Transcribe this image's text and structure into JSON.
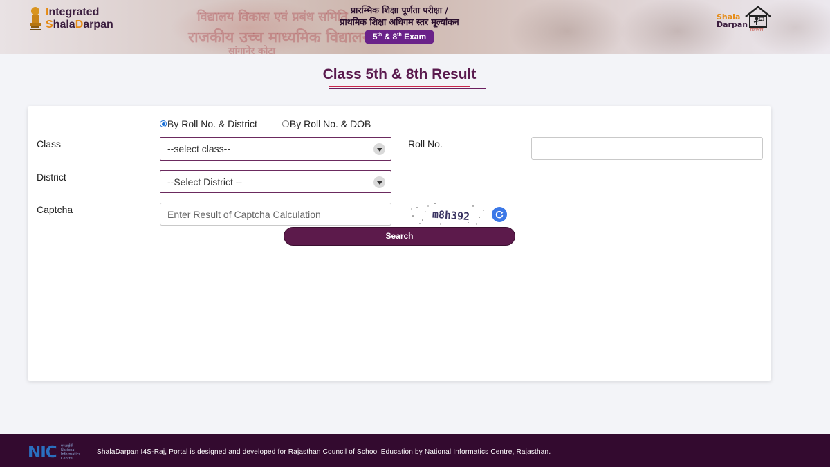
{
  "header": {
    "brand_line1_prefix": "I",
    "brand_line1_rest": "ntegrated",
    "brand_line2_s": "S",
    "brand_line2_mid": "hala",
    "brand_line2_d": "D",
    "brand_line2_end": "arpan",
    "banner_bg_line1": "विद्यालय विकास एवं प्रबंध समिति",
    "banner_bg_line2": "राजकीय उच्च माध्यमिक विद्यालय",
    "banner_bg_line3": "सांगानेर कोटा",
    "exam_line1": "प्रारम्भिक शिक्षा पूर्णता परीक्षा /",
    "exam_line2": "प्राथमिक शिक्षा अधिगम स्तर मूल्यांकन",
    "exam_badge_5": "5",
    "exam_badge_sup1": "th",
    "exam_badge_and": " & 8",
    "exam_badge_sup2": "th",
    "exam_badge_exam": " Exam",
    "right_logo_line1": "Shala",
    "right_logo_line2": "Darpan",
    "right_logo_sub": "राजस्थान"
  },
  "page": {
    "title": "Class 5th & 8th Result"
  },
  "form": {
    "search_mode_options": [
      {
        "label": "By Roll No. & District",
        "checked": true
      },
      {
        "label": "By Roll No. & DOB",
        "checked": false
      }
    ],
    "class_label": "Class",
    "class_select_value": "--select class--",
    "rollno_label": "Roll No.",
    "rollno_value": "",
    "district_label": "District",
    "district_select_value": "--Select District --",
    "captcha_label": "Captcha",
    "captcha_placeholder": "Enter Result of Captcha Calculation",
    "captcha_text": "m8h392",
    "search_button": "Search"
  },
  "footer": {
    "nic_label": "NIC",
    "nic_sub_hi": "एनआईसी",
    "nic_sub_l1": "National",
    "nic_sub_l2": "Informatics",
    "nic_sub_l3": "Centre",
    "text": "ShalaDarpan I4S-Raj, Portal is designed and developed for Rajasthan Council of School Education by National Informatics Centre, Rajasthan."
  },
  "colors": {
    "brand_purple": "#5c1a4b",
    "accent_orange": "#e58a14",
    "badge_purple": "#6a2289",
    "footer_bg": "#330a2f",
    "radio_blue": "#1a6fd6"
  }
}
